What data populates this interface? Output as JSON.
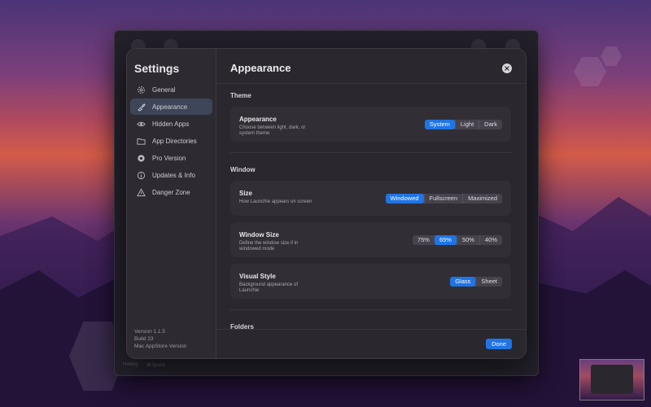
{
  "sidebar": {
    "title": "Settings",
    "items": [
      {
        "label": "General",
        "icon": "gear-icon"
      },
      {
        "label": "Appearance",
        "icon": "brush-icon",
        "active": true
      },
      {
        "label": "Hidden Apps",
        "icon": "eye-icon"
      },
      {
        "label": "App Directories",
        "icon": "folder-icon"
      },
      {
        "label": "Pro Version",
        "icon": "pro-badge-icon"
      },
      {
        "label": "Updates & Info",
        "icon": "info-icon"
      },
      {
        "label": "Danger Zone",
        "icon": "warning-icon"
      }
    ],
    "version": {
      "line1": "Version 1.1.5",
      "line2": "Build 23",
      "line3": "Mac AppStore Version"
    }
  },
  "main": {
    "title": "Appearance",
    "sections": {
      "theme": {
        "title": "Theme",
        "appearance": {
          "title": "Appearance",
          "desc": "Choose between light, dark, or system theme",
          "options": [
            "System",
            "Light",
            "Dark"
          ],
          "selected": "System"
        }
      },
      "window": {
        "title": "Window",
        "size": {
          "title": "Size",
          "desc": "How Launchie appears on screen",
          "options": [
            "Windowed",
            "Fullscreen",
            "Maximized"
          ],
          "selected": "Windowed"
        },
        "window_size": {
          "title": "Window Size",
          "desc": "Define the window size if in windowed mode",
          "options": [
            "75%",
            "65%",
            "50%",
            "40%"
          ],
          "selected": "65%"
        },
        "visual_style": {
          "title": "Visual Style",
          "desc": "Background appearance of Launchie",
          "options": [
            "Glass",
            "Sheet"
          ],
          "selected": "Glass"
        }
      },
      "folders": {
        "title": "Folders"
      }
    },
    "done_label": "Done"
  },
  "background": {
    "hotkey": "Hotkey",
    "spaces": "⌘Space"
  },
  "colors": {
    "accent": "#1f74e6",
    "modal_bg": "#2a272e",
    "sidebar_active": "#3d4658"
  }
}
